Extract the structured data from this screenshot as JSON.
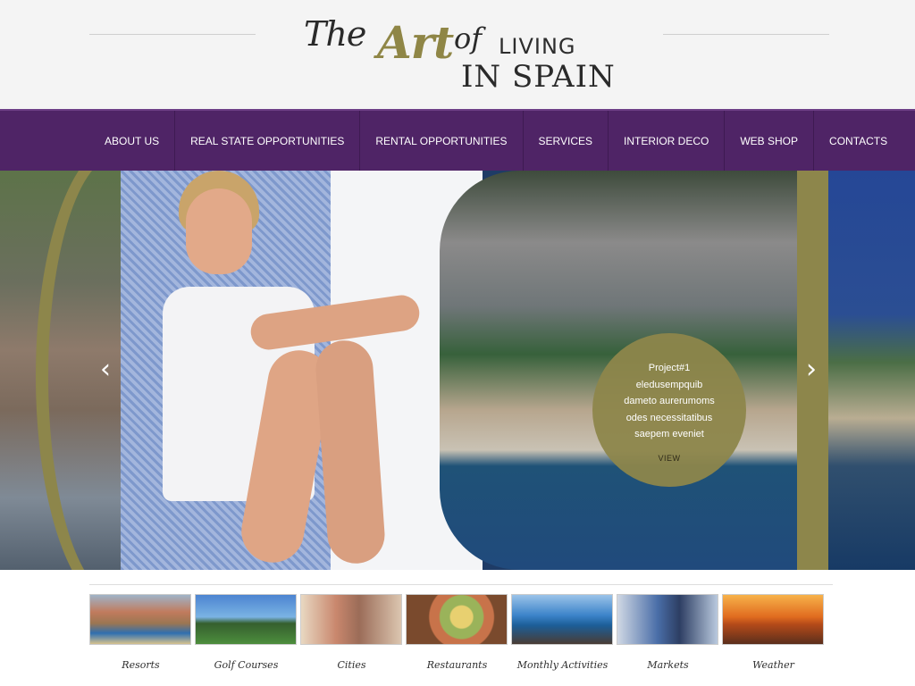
{
  "logo": {
    "the": "The",
    "art": "Art",
    "of": "of",
    "living": "LIVING",
    "in_spain": "IN SPAIN"
  },
  "nav": {
    "items": [
      {
        "label": "ABOUT US"
      },
      {
        "label": "REAL STATE OPPORTUNITIES"
      },
      {
        "label": "RENTAL OPPORTUNITIES"
      },
      {
        "label": "SERVICES"
      },
      {
        "label": "INTERIOR DECO"
      },
      {
        "label": "WEB SHOP"
      },
      {
        "label": "CONTACTS"
      }
    ]
  },
  "slider": {
    "prev_icon": "chevron-left-icon",
    "next_icon": "chevron-right-icon",
    "caption": {
      "title": "Project#1",
      "lines": [
        "eledusempquib",
        "dameto aurerumoms",
        "odes necessitatibus",
        "saepem eveniet"
      ],
      "view_label": "VIEW"
    }
  },
  "categories": [
    {
      "label": "Resorts"
    },
    {
      "label": "Golf Courses"
    },
    {
      "label": "Cities"
    },
    {
      "label": "Restaurants"
    },
    {
      "label": "Monthly Activities"
    },
    {
      "label": "Markets"
    },
    {
      "label": "Weather"
    }
  ],
  "colors": {
    "nav_bg": "#4f2466",
    "accent_gold": "#8d864b"
  }
}
